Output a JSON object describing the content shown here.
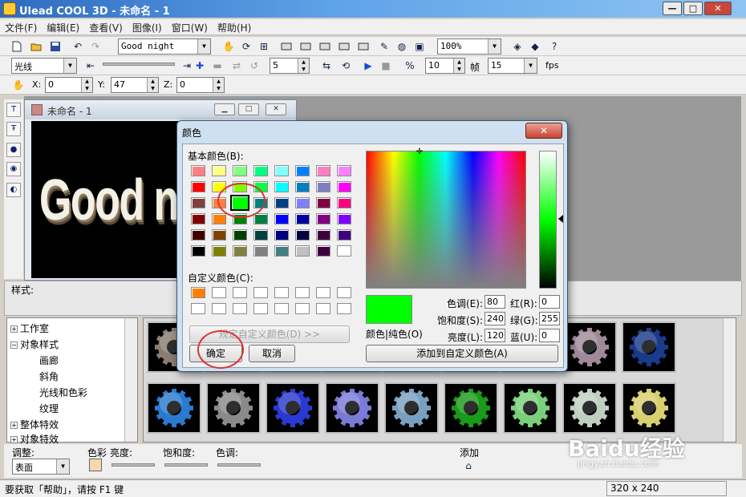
{
  "window": {
    "title": "Ulead COOL 3D - 未命名 - 1",
    "min": "—",
    "max": "□",
    "close": "✕"
  },
  "menu": [
    "文件(F)",
    "编辑(E)",
    "查看(V)",
    "图像(I)",
    "窗口(W)",
    "帮助(H)"
  ],
  "toolbar": {
    "text_combo": "Good night",
    "zoom_combo": "100%"
  },
  "toolbar2": {
    "mode_combo": "光线",
    "spin1": "5",
    "spin2": "10",
    "frame_label": "帧",
    "spin3": "15",
    "fps_label": "fps"
  },
  "toolbar3": {
    "x_label": "X:",
    "x_value": "0",
    "y_label": "Y:",
    "y_value": "47",
    "z_label": "Z:",
    "z_value": "0"
  },
  "document": {
    "title": "未命名 - 1",
    "canvas_text": "Good n"
  },
  "style_panel": {
    "label": "样式:"
  },
  "tree": [
    {
      "label": "工作室",
      "expander": "+"
    },
    {
      "label": "对象样式",
      "expander": "−"
    },
    {
      "label": "画廊",
      "expander": ""
    },
    {
      "label": "斜角",
      "expander": ""
    },
    {
      "label": "光线和色彩",
      "expander": ""
    },
    {
      "label": "纹理",
      "expander": ""
    },
    {
      "label": "整体特效",
      "expander": "+"
    },
    {
      "label": "对象特效",
      "expander": "+"
    }
  ],
  "gallery": {
    "row1_colors": [
      "#8a7d70",
      "#9a9a9a",
      "#6b6b6b",
      "#7777aa",
      "#5a5a9a",
      "#3b6a3b",
      "#7f7f7f",
      "#a08a9a",
      "#1a3a8a"
    ],
    "row2_colors": [
      "#2a7ad0",
      "#8a8a8a",
      "#2a3ad0",
      "#7a7ad8",
      "#7aa0c0",
      "#1a9a1a",
      "#7ad07a",
      "#c0d0c0",
      "#d8d070"
    ]
  },
  "adjust": {
    "label": "调整:",
    "combo": "表面",
    "color_label": "色彩",
    "brightness_label": "亮度:",
    "saturation_label": "饱和度:",
    "hue_label": "色调:",
    "add_label": "添加"
  },
  "status": {
    "text": "要获取「帮助」，请按 F1 键",
    "size": "320 x 240"
  },
  "color_dialog": {
    "title": "颜色",
    "close": "✕",
    "basic_label": "基本颜色(B):",
    "basic_colors": [
      [
        "#ff8080",
        "#ffff80",
        "#80ff80",
        "#00ff80",
        "#80ffff",
        "#0080ff",
        "#ff80c0",
        "#ff80ff"
      ],
      [
        "#ff0000",
        "#ffff00",
        "#80ff00",
        "#00ff40",
        "#00ffff",
        "#0080c0",
        "#8080c0",
        "#ff00ff"
      ],
      [
        "#804040",
        "#ff8040",
        "#00ff00",
        "#008080",
        "#004080",
        "#8080ff",
        "#800040",
        "#ff0080"
      ],
      [
        "#800000",
        "#ff8000",
        "#008000",
        "#008040",
        "#0000ff",
        "#0000a0",
        "#800080",
        "#8000ff"
      ],
      [
        "#400000",
        "#804000",
        "#004000",
        "#004040",
        "#000080",
        "#000040",
        "#400040",
        "#400080"
      ],
      [
        "#000000",
        "#808000",
        "#808040",
        "#808080",
        "#408080",
        "#c0c0c0",
        "#400040",
        "#ffffff"
      ]
    ],
    "custom_label": "自定义颜色(C):",
    "define_button": "规定自定义颜色(D) >>",
    "ok_button": "确定",
    "cancel_button": "取消",
    "preview_label": "颜色|纯色(O)",
    "hue_label": "色调(E):",
    "hue_value": "80",
    "sat_label": "饱和度(S):",
    "sat_value": "240",
    "lum_label": "亮度(L):",
    "lum_value": "120",
    "red_label": "红(R):",
    "red_value": "0",
    "green_label": "绿(G):",
    "green_value": "255",
    "blue_label": "蓝(U):",
    "blue_value": "0",
    "add_custom_button": "添加到自定义颜色(A)",
    "current_color": "#00ff00"
  },
  "watermark": {
    "text": "Baidu经验",
    "sub": "jingyan.baidu.com"
  }
}
